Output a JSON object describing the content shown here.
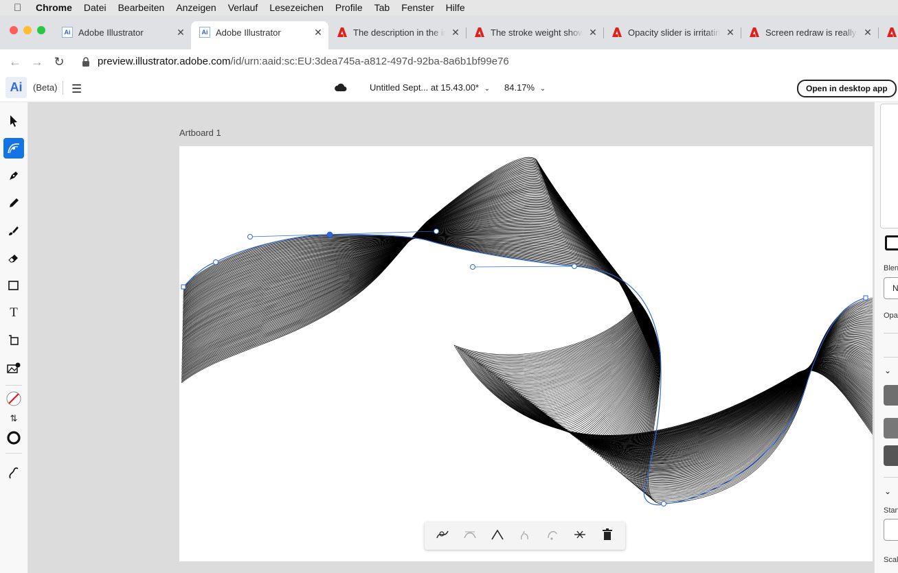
{
  "menubar": {
    "apple": "",
    "items": [
      "Chrome",
      "Datei",
      "Bearbeiten",
      "Anzeigen",
      "Verlauf",
      "Lesezeichen",
      "Profile",
      "Tab",
      "Fenster",
      "Hilfe"
    ]
  },
  "tabs": [
    {
      "title": "Adobe Illustrator",
      "icon": "illustrator-icon",
      "active": false
    },
    {
      "title": "Adobe Illustrator",
      "icon": "illustrator-icon",
      "active": true
    },
    {
      "title": "The description in the in",
      "icon": "adobe-icon",
      "active": false
    },
    {
      "title": "The stroke weight show",
      "icon": "adobe-icon",
      "active": false
    },
    {
      "title": "Opacity slider is irritatin",
      "icon": "adobe-icon",
      "active": false
    },
    {
      "title": "Screen redraw is really v",
      "icon": "adobe-icon",
      "active": false
    }
  ],
  "address": {
    "host": "preview.illustrator.adobe.com",
    "path": "/id/urn:aaid:sc:EU:3dea745a-a812-497d-92ba-8a6b1bf99e76"
  },
  "app": {
    "logo": "Ai",
    "beta": "(Beta)",
    "doc_title": "Untitled Sept... at 15.43.00*",
    "zoom": "84.17%",
    "open_desktop": "Open in desktop app"
  },
  "canvas": {
    "artboard_label": "Artboard 1"
  },
  "toolbar": {
    "tools": [
      "selection-tool",
      "blend-anchor-tool",
      "pen-tool",
      "pencil-tool",
      "paintbrush-tool",
      "eraser-tool",
      "rectangle-tool",
      "type-tool",
      "transform-tool",
      "image-trace-tool",
      "fill-none-swatch",
      "swap-fill-stroke",
      "stroke-swatch",
      "blend-path-tool"
    ]
  },
  "context_bar": {
    "buttons": [
      "replace-spine-icon",
      "smooth-point-icon",
      "corner-point-icon",
      "anchor-add-icon",
      "anchor-convert-icon",
      "cut-path-icon",
      "trash-icon"
    ]
  },
  "right_panel": {
    "blend_label": "Blen",
    "opacity_label": "Opac",
    "start_label": "Start",
    "scale_label": "Scale",
    "field_value": "N"
  },
  "colors": {
    "accent": "#1473e6",
    "path_selection": "#2b67d6",
    "traffic_red": "#fe5f57",
    "traffic_yellow": "#febc2e",
    "traffic_green": "#28c840"
  }
}
